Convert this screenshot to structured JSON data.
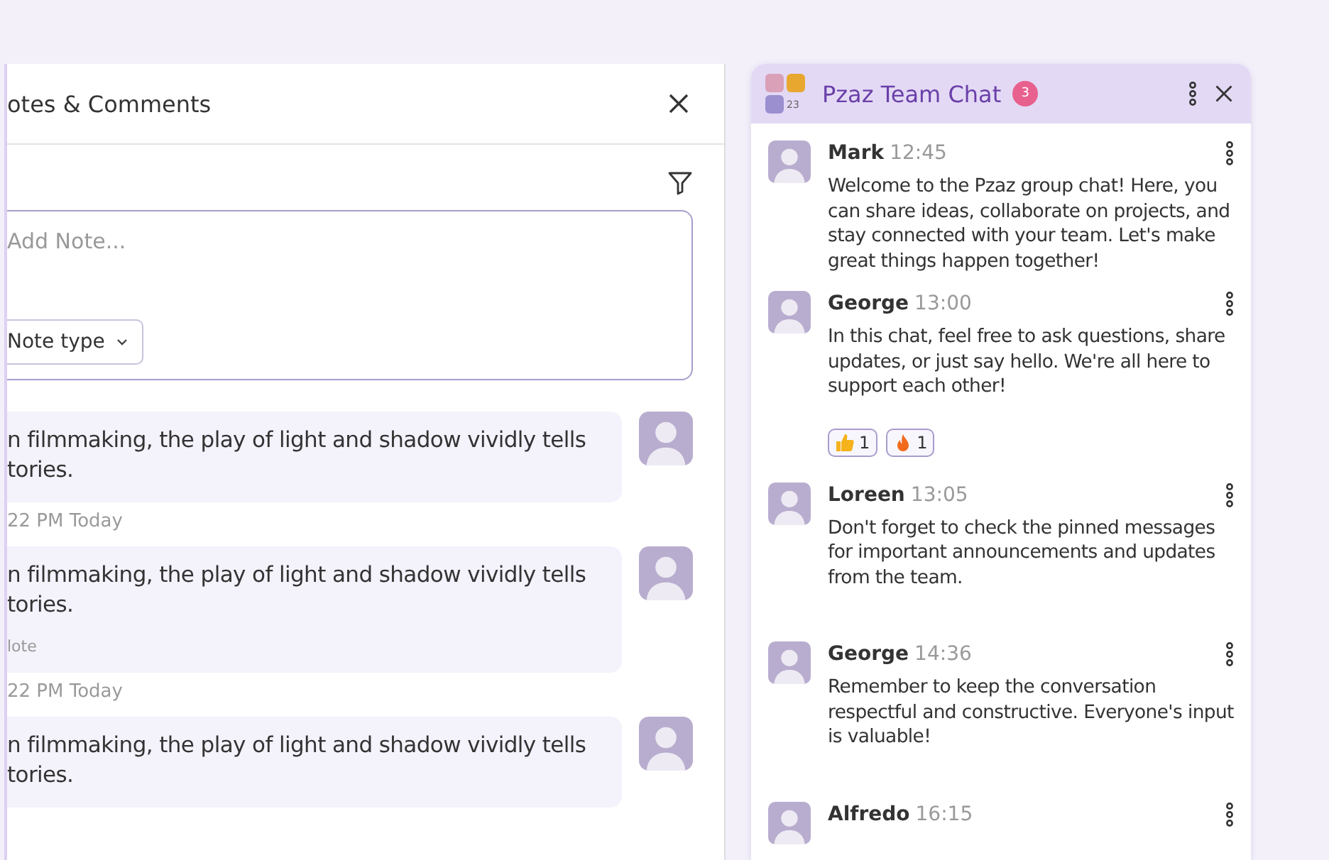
{
  "notes_panel": {
    "title": "otes & Comments",
    "input": {
      "placeholder": "Add Note..."
    },
    "note_type": {
      "label": "Note type"
    },
    "notes": [
      {
        "lines": [
          "n filmmaking, the play of light and shadow vividly tells",
          "tories."
        ],
        "time": "22 PM Today"
      },
      {
        "lines": [
          "n filmmaking, the play of light and shadow vividly tells",
          "tories."
        ],
        "tag": "lote",
        "time": "22 PM Today"
      },
      {
        "lines": [
          "n filmmaking, the play of light and shadow vividly tells",
          "tories."
        ]
      }
    ]
  },
  "chat": {
    "title": "Pzaz Team Chat",
    "member_count": "23",
    "unread": "3",
    "messages": [
      {
        "name": "Mark",
        "time": "12:45",
        "text": "Welcome to the Pzaz group chat! Here, you can share ideas, collaborate on projects, and stay connected with your team. Let's make great things happen together!"
      },
      {
        "name": "George",
        "time": "13:00",
        "text": "In this chat, feel free to ask questions, share updates, or just say hello. We're all here to support each other!",
        "reactions": [
          {
            "kind": "thumbs_up",
            "count": "1"
          },
          {
            "kind": "fire",
            "count": "1"
          }
        ]
      },
      {
        "name": "Loreen",
        "time": "13:05",
        "text": "Don't forget to check the pinned messages for important announcements and updates from the team."
      },
      {
        "name": "George",
        "time": "14:36",
        "text": "Remember to keep the conversation respectful and constructive. Everyone's input is valuable!"
      },
      {
        "name": "Alfredo",
        "time": "16:15"
      }
    ]
  }
}
